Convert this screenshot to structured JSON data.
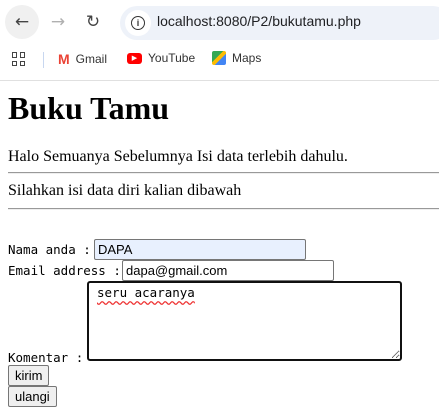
{
  "browser": {
    "url": "localhost:8080/P2/bukutamu.php",
    "bookmarks": [
      {
        "label": "Gmail",
        "color": "#ea4335"
      },
      {
        "label": "YouTube",
        "color": "#ff0000"
      },
      {
        "label": "Maps",
        "color": "#34a853"
      }
    ]
  },
  "page": {
    "title": "Buku Tamu",
    "intro": "Halo Semuanya Sebelumnya Isi data terlebih dahulu.",
    "instruction": "Silahkan isi data diri kalian dibawah"
  },
  "form": {
    "name_label": "Nama anda :",
    "name_value": "DAPA",
    "email_label": "Email address :",
    "email_value": "dapa@gmail.com",
    "comment_label": "Komentar :",
    "comment_value": "seru acaranya",
    "submit_label": "kirim",
    "reset_label": "ulangi"
  }
}
